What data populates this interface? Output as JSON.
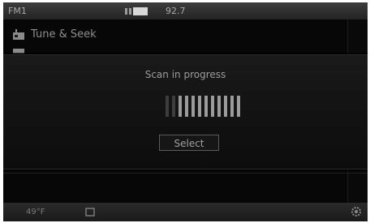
{
  "status_bar": {
    "band": "FM1",
    "frequency": "92.7",
    "rds_icon": "radio-signal-icon"
  },
  "menu": {
    "items": [
      {
        "label": "Tune & Seek",
        "icon": "tune-icon"
      },
      {
        "label": "",
        "icon": "preset-icon"
      }
    ]
  },
  "dialog": {
    "title": "Scan in progress",
    "progress_fraction": 0.8,
    "button_label": "Select"
  },
  "bottom_bar": {
    "temperature": "49°F",
    "left_icon": "home-icon",
    "right_icon": "gear-icon"
  }
}
